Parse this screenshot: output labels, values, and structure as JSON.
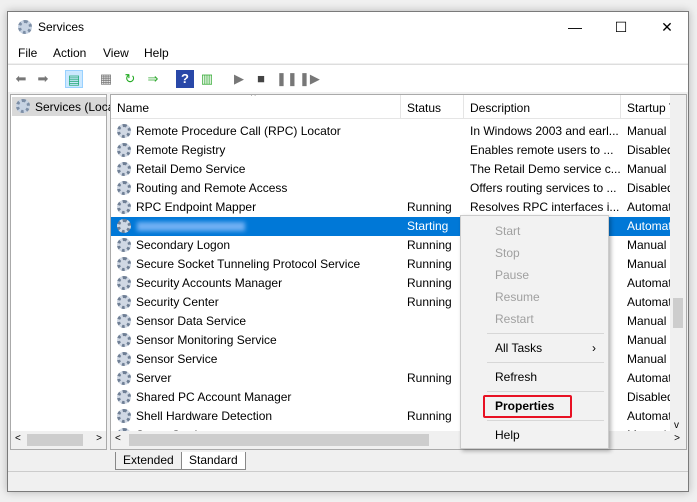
{
  "window": {
    "title": "Services",
    "minimize": "—",
    "maximize": "☐",
    "close": "✕"
  },
  "menu": [
    "File",
    "Action",
    "View",
    "Help"
  ],
  "tree": {
    "root": "Services (Local)"
  },
  "columns": [
    "Name",
    "Status",
    "Description",
    "Startup Type"
  ],
  "rows": [
    {
      "name": "Remote Procedure Call (RPC) Locator",
      "status": "",
      "description": "In Windows 2003 and earl...",
      "startup": "Manual"
    },
    {
      "name": "Remote Registry",
      "status": "",
      "description": "Enables remote users to ...",
      "startup": "Disabled"
    },
    {
      "name": "Retail Demo Service",
      "status": "",
      "description": "The Retail Demo service c...",
      "startup": "Manual"
    },
    {
      "name": "Routing and Remote Access",
      "status": "",
      "description": "Offers routing services to ...",
      "startup": "Disabled"
    },
    {
      "name": "RPC Endpoint Mapper",
      "status": "Running",
      "description": "Resolves RPC interfaces i...",
      "startup": "Automatic"
    },
    {
      "name": "",
      "status": "Starting",
      "description": "",
      "startup": "Automatic",
      "selected": true
    },
    {
      "name": "Secondary Logon",
      "status": "Running",
      "description": "",
      "startup": "Manual"
    },
    {
      "name": "Secure Socket Tunneling Protocol Service",
      "status": "Running",
      "description": "",
      "startup": "Manual"
    },
    {
      "name": "Security Accounts Manager",
      "status": "Running",
      "description": "",
      "startup": "Automatic"
    },
    {
      "name": "Security Center",
      "status": "Running",
      "description": "",
      "startup": "Automatic"
    },
    {
      "name": "Sensor Data Service",
      "status": "",
      "description": "",
      "startup": "Manual"
    },
    {
      "name": "Sensor Monitoring Service",
      "status": "",
      "description": "",
      "startup": "Manual"
    },
    {
      "name": "Sensor Service",
      "status": "",
      "description": "",
      "startup": "Manual"
    },
    {
      "name": "Server",
      "status": "Running",
      "description": "",
      "startup": "Automatic"
    },
    {
      "name": "Shared PC Account Manager",
      "status": "",
      "description": "",
      "startup": "Disabled"
    },
    {
      "name": "Shell Hardware Detection",
      "status": "Running",
      "description": "",
      "startup": "Automatic"
    },
    {
      "name": "Smart Card",
      "status": "",
      "description": "",
      "startup": "Manual"
    }
  ],
  "context_menu": {
    "items": [
      {
        "label": "Start",
        "disabled": true
      },
      {
        "label": "Stop",
        "disabled": true
      },
      {
        "label": "Pause",
        "disabled": true
      },
      {
        "label": "Resume",
        "disabled": true
      },
      {
        "label": "Restart",
        "disabled": true
      },
      {
        "label": "All Tasks",
        "submenu": true
      },
      {
        "label": "Refresh"
      },
      {
        "label": "Properties",
        "bold": true,
        "highlighted": true
      },
      {
        "label": "Help"
      }
    ],
    "highlight_color": "#e81123"
  },
  "tabs": [
    "Extended",
    "Standard"
  ],
  "selection_color": "#0078d7"
}
